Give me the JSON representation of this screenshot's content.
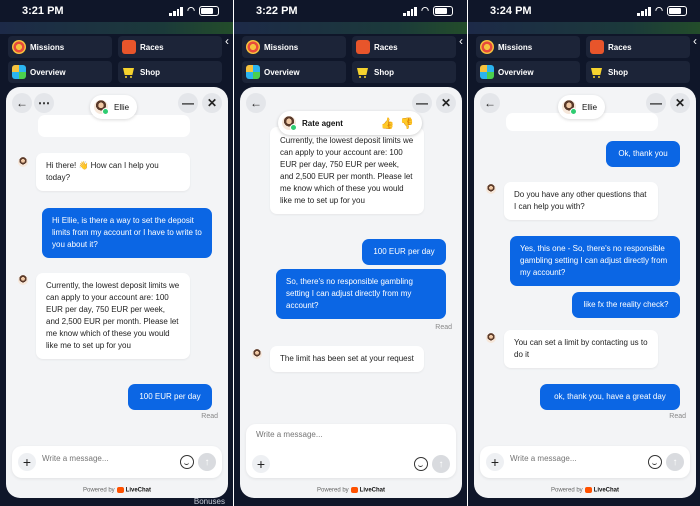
{
  "nav": {
    "missions": "Missions",
    "races": "Races",
    "overview": "Overview",
    "shop": "Shop"
  },
  "footer": {
    "bonuses": "Bonuses",
    "powered_prefix": "Powered by",
    "brand": "LiveChat"
  },
  "composer": {
    "placeholder_short": "Write a message...",
    "placeholder_long": "Write a message..."
  },
  "agent": {
    "name": "Ellie"
  },
  "rate": {
    "label": "Rate agent"
  },
  "read_label": "Read",
  "screens": [
    {
      "time": "3:21 PM",
      "messages": [
        {
          "from": "agent",
          "text": "Hi there! 👋 How can I help you today?"
        },
        {
          "from": "user",
          "text": "Hi Ellie, is there a way to set the deposit limits from my account or I have to write to you about it?"
        },
        {
          "from": "agent",
          "text": "Currently, the lowest deposit limits we can apply to your account are: 100 EUR per day, 750 EUR per week, and 2,500 EUR per month. Please let me know which of these you would like me to set up for you"
        },
        {
          "from": "user",
          "text": "100 EUR per day"
        }
      ]
    },
    {
      "time": "3:22 PM",
      "messages": [
        {
          "from": "agent",
          "text": "Currently, the lowest deposit limits we can apply to your account are: 100 EUR per day, 750 EUR per week, and 2,500 EUR per month. Please let me know which of these you would like me to set up for you"
        },
        {
          "from": "user",
          "text": "100 EUR per day"
        },
        {
          "from": "user",
          "text": "So, there's no responsible gambling setting I can adjust directly from my account?"
        },
        {
          "from": "agent",
          "text": "The limit has been set at your request"
        }
      ]
    },
    {
      "time": "3:24 PM",
      "messages": [
        {
          "from": "user",
          "text": "Ok, thank you"
        },
        {
          "from": "agent",
          "text": "Do you have any other questions that I can help you with?"
        },
        {
          "from": "user",
          "text": "Yes, this one - So, there's no responsible gambling setting I can adjust directly from my account?"
        },
        {
          "from": "user",
          "text": "like fx the reality check?"
        },
        {
          "from": "agent",
          "text": "You can set a limit by contacting us to do it"
        },
        {
          "from": "user",
          "text": "ok, thank you, have a great day"
        }
      ]
    }
  ]
}
